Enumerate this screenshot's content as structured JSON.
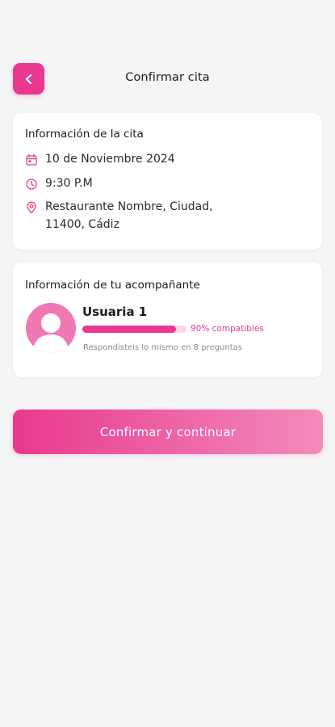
{
  "header": {
    "title": "Confirmar cita"
  },
  "appointment": {
    "heading": "Información de la cita",
    "date": "10 de Noviembre 2024",
    "time": "9:30 P.M",
    "place_line1": "Restaurante Nombre, Ciudad,",
    "place_line2": "11400, Cádiz"
  },
  "companion": {
    "heading": "Información de tu acompañante",
    "name": "Usuaria 1",
    "compatibility_percent": 90,
    "compatibility_label": "90% compatibles",
    "same_answers": "Respondisteis lo mismo en 8 preguntas"
  },
  "cta": {
    "label": "Confirmar y continuar"
  },
  "colors": {
    "accent": "#e8398f",
    "accent_light": "#f28bbb",
    "avatar_bg": "#f079b3"
  }
}
